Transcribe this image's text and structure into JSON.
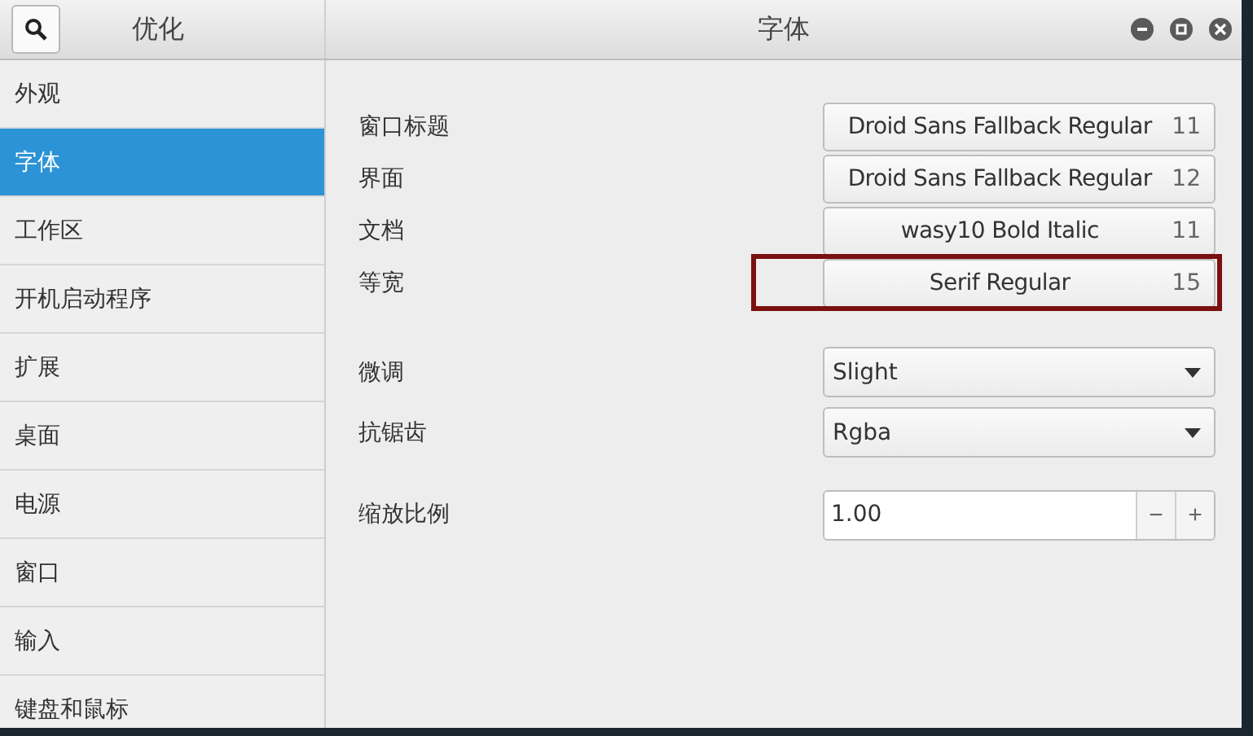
{
  "sidebar": {
    "title": "优化",
    "items": [
      {
        "label": "外观",
        "selected": false
      },
      {
        "label": "字体",
        "selected": true
      },
      {
        "label": "工作区",
        "selected": false
      },
      {
        "label": "开机启动程序",
        "selected": false
      },
      {
        "label": "扩展",
        "selected": false
      },
      {
        "label": "桌面",
        "selected": false
      },
      {
        "label": "电源",
        "selected": false
      },
      {
        "label": "窗口",
        "selected": false
      },
      {
        "label": "输入",
        "selected": false
      },
      {
        "label": "键盘和鼠标",
        "selected": false
      }
    ]
  },
  "window": {
    "title": "字体"
  },
  "fonts": [
    {
      "label": "窗口标题",
      "font": "Droid Sans Fallback Regular",
      "size": "11",
      "highlighted": false
    },
    {
      "label": "界面",
      "font": "Droid Sans Fallback Regular",
      "size": "12",
      "highlighted": false
    },
    {
      "label": "文档",
      "font": "wasy10 Bold Italic",
      "size": "11",
      "highlighted": false
    },
    {
      "label": "等宽",
      "font": "Serif Regular",
      "size": "15",
      "highlighted": true
    }
  ],
  "options": [
    {
      "label": "微调",
      "value": "Slight"
    },
    {
      "label": "抗锯齿",
      "value": "Rgba"
    }
  ],
  "scale": {
    "label": "缩放比例",
    "value": "1.00",
    "minus": "−",
    "plus": "+"
  }
}
